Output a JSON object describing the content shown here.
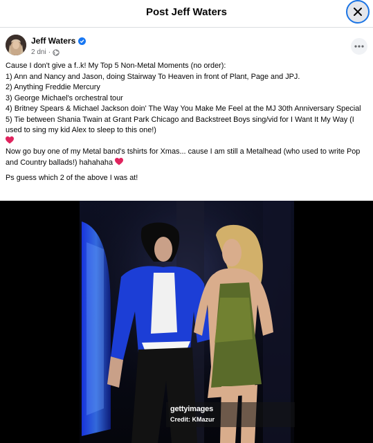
{
  "dialog": {
    "title": "Post Jeff Waters",
    "close_icon": "close-icon"
  },
  "post": {
    "author": "Jeff Waters",
    "verified_icon": "verified-badge-icon",
    "time": "2 dni",
    "audience_icon": "globe-icon",
    "more_icon": "more-options-icon",
    "lines": [
      "Cause I don't give a f..k! My Top 5 Non-Metal Moments (no order):",
      "1) Ann and Nancy and Jason, doing Stairway To Heaven in front of Plant, Page and JPJ.",
      "2) Anything Freddie Mercury",
      "3) George Michael's orchestral tour",
      "4) Britney Spears & Michael Jackson doin' The Way You Make Me Feel at the MJ 30th Anniversary Special",
      "5) Tie between Shania Twain at Grant Park Chicago and Backstreet Boys sing/vid for I Want It My Way (I used to sing my kid Alex to sleep to this one!)"
    ],
    "para2": "Now go buy one of my Metal band's tshirts for Xmas... cause I am still a Metalhead (who used to write Pop and Country ballads!) hahahaha",
    "para3": "Ps guess which 2 of the above I was at!",
    "heart_icon": "red-heart-emoji"
  },
  "photo": {
    "watermark": "gettyimages",
    "credit": "Credit: KMazur"
  },
  "colors": {
    "accent": "#1877f2",
    "heart": "#e0245e",
    "photo_bg": "#0b0d16"
  }
}
